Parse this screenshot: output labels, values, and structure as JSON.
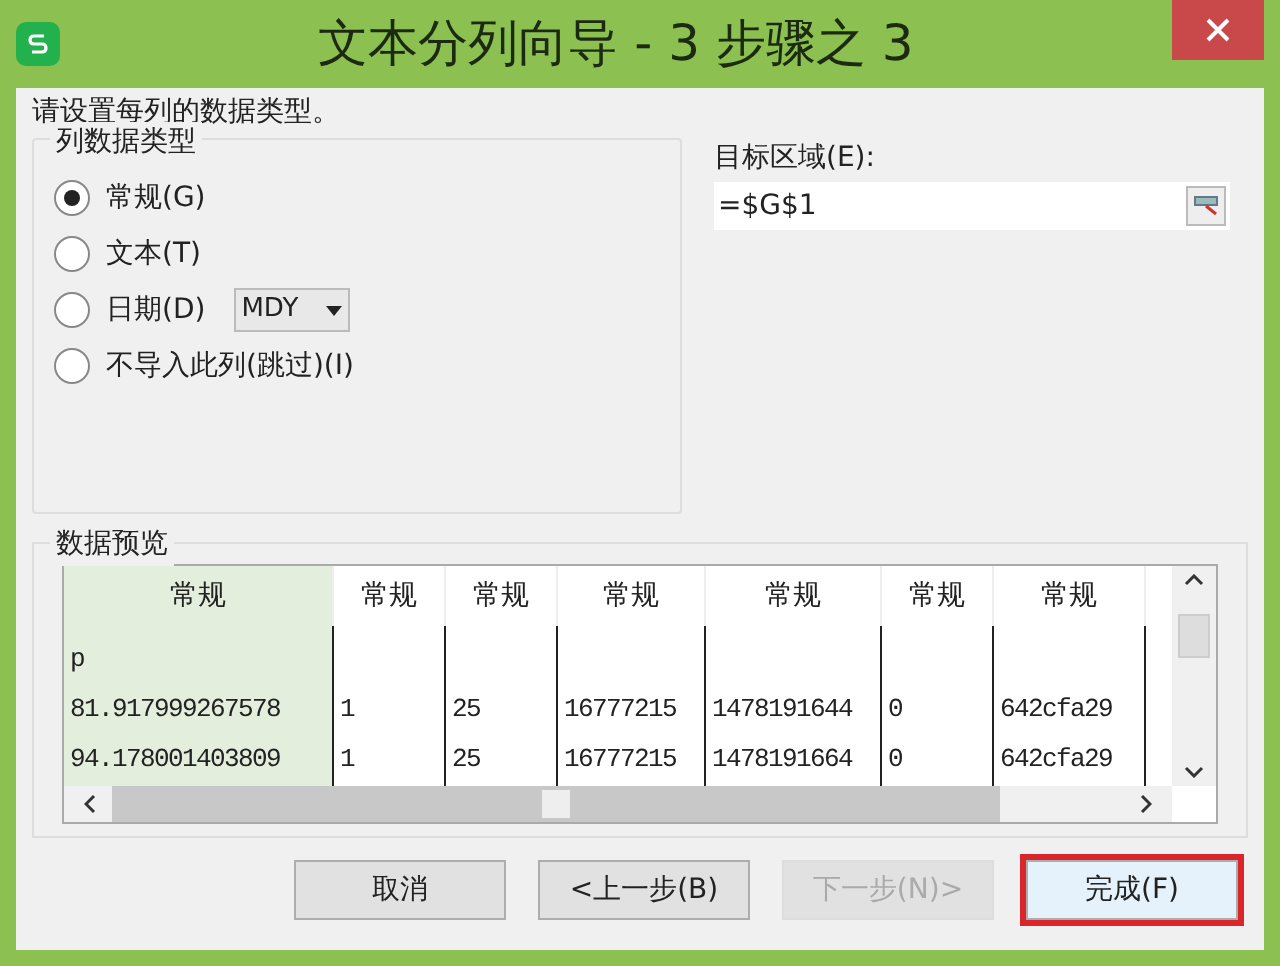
{
  "window": {
    "title": "文本分列向导 - 3 步骤之 3"
  },
  "instruction": "请设置每列的数据类型。",
  "column_type": {
    "legend": "列数据类型",
    "options": [
      {
        "label": "常规(G)",
        "selected": true
      },
      {
        "label": "文本(T)",
        "selected": false
      },
      {
        "label": "日期(D)",
        "selected": false,
        "kind": "date",
        "dropdown": "MDY"
      },
      {
        "label": "不导入此列(跳过)(I)",
        "selected": false
      }
    ]
  },
  "destination": {
    "label": "目标区域(E):",
    "value": "=$G$1"
  },
  "preview": {
    "legend": "数据预览",
    "columns": [
      {
        "header": "常规",
        "selected": true
      },
      {
        "header": "常规",
        "selected": false
      },
      {
        "header": "常规",
        "selected": false
      },
      {
        "header": "常规",
        "selected": false
      },
      {
        "header": "常规",
        "selected": false
      },
      {
        "header": "常规",
        "selected": false
      },
      {
        "header": "常规",
        "selected": false
      }
    ],
    "rows": [
      [
        "p",
        "",
        "",
        "",
        "",
        "",
        ""
      ],
      [
        "81.917999267578",
        "1",
        "25",
        "16777215",
        "1478191644",
        "0",
        "642cfa29"
      ],
      [
        "94.178001403809",
        "1",
        "25",
        "16777215",
        "1478191664",
        "0",
        "642cfa29"
      ]
    ]
  },
  "buttons": [
    {
      "label": "取消",
      "disabled": false,
      "highlighted": false
    },
    {
      "label": "<上一步(B)",
      "disabled": false,
      "highlighted": false
    },
    {
      "label": "下一步(N)>",
      "disabled": true,
      "highlighted": false
    },
    {
      "label": "完成(F)",
      "disabled": false,
      "highlighted": true
    }
  ]
}
